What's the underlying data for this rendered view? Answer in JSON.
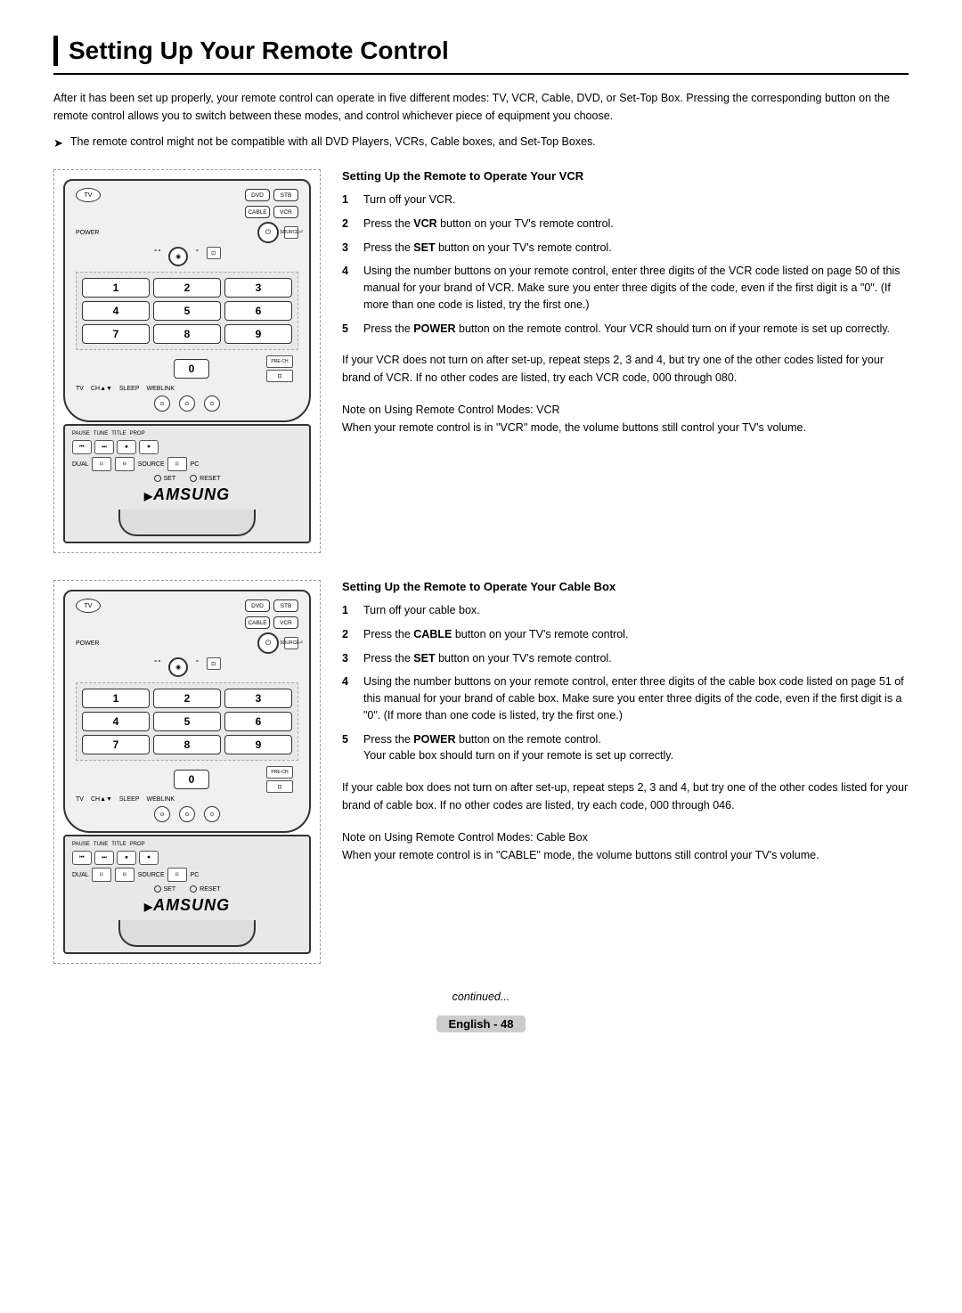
{
  "page": {
    "title": "Setting Up Your Remote Control",
    "intro": "After it has been set up properly, your remote control can operate in five different modes: TV, VCR, Cable, DVD, or Set-Top Box. Pressing the corresponding button on the remote control allows you to switch between these modes, and control whichever piece of equipment you choose.",
    "note": "The remote control might not be compatible with all DVD Players, VCRs, Cable boxes, and Set-Top Boxes.",
    "continued": "continued...",
    "page_badge": "English - 48"
  },
  "vcr_section": {
    "title": "Setting Up the Remote to Operate Your VCR",
    "steps": [
      {
        "num": "1",
        "text": "Turn off your VCR."
      },
      {
        "num": "2",
        "text": "Press the VCR button on your TV's remote control.",
        "bold": "VCR"
      },
      {
        "num": "3",
        "text": "Press the SET button on your TV's remote control.",
        "bold": "SET"
      },
      {
        "num": "4",
        "text": "Using the number buttons on your remote control, enter three digits of the VCR code listed on page 50 of this manual for your brand of VCR. Make sure you enter three digits of the code, even if the first digit is a \"0\". (If more than one code is listed, try the first one.)"
      },
      {
        "num": "5",
        "text": "Press the POWER button on the remote control. Your VCR should turn on if your remote is set up correctly.",
        "bold": "POWER"
      }
    ],
    "if_not_work": "If your VCR does not turn on after set-up, repeat steps 2, 3 and 4, but try one of the other codes listed for your brand of VCR. If no other codes are listed, try each VCR code, 000 through 080.",
    "note_title": "Note on Using Remote Control Modes: VCR",
    "note_text": "When your remote control is in \"VCR\" mode, the volume buttons still control your TV's volume."
  },
  "cable_section": {
    "title": "Setting Up the Remote to Operate Your Cable Box",
    "steps": [
      {
        "num": "1",
        "text": "Turn off your cable box."
      },
      {
        "num": "2",
        "text": "Press the CABLE button on your TV's remote control.",
        "bold": "CABLE"
      },
      {
        "num": "3",
        "text": "Press the SET button on your TV's remote control.",
        "bold": "SET"
      },
      {
        "num": "4",
        "text": "Using the number buttons on your remote control, enter three digits of the cable box code listed on page 51 of this manual for your brand of cable box. Make sure you enter three digits of the code, even if the first digit is a \"0\". (If more than one code is listed, try the first one.)"
      },
      {
        "num": "5",
        "text": "Press the POWER button on the remote control. Your cable box should turn on if your remote is set up correctly.",
        "bold": "POWER"
      }
    ],
    "if_not_work": "If your cable box does not turn on after set-up, repeat steps 2, 3 and 4, but try one of the other codes listed for your brand of cable box. If no other codes are listed, try each code, 000 through 046.",
    "note_title": "Note on Using Remote Control Modes: Cable Box",
    "note_text": "When your remote control is in \"CABLE\" mode, the volume buttons still control your TV's volume."
  },
  "remote": {
    "buttons": {
      "tv": "TV",
      "dvd": "DVD",
      "stb": "STB",
      "cable": "CABLE",
      "vcr": "VCR",
      "power": "⏻",
      "nums": [
        "1",
        "2",
        "3",
        "4",
        "5",
        "6",
        "7",
        "8",
        "9",
        "0"
      ],
      "samsung": "AMSUNG"
    }
  }
}
